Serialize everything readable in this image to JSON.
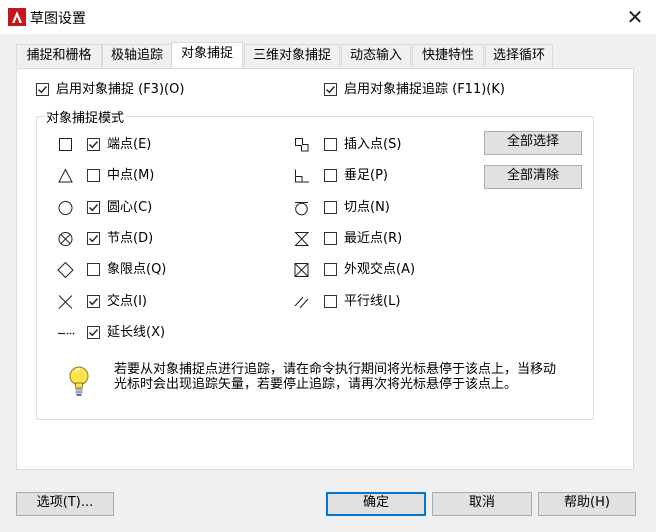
{
  "window": {
    "title": "草图设置",
    "close_icon": "close-icon",
    "app_icon": "autocad-icon"
  },
  "tabs": [
    {
      "label": "捕捉和栅格"
    },
    {
      "label": "极轴追踪"
    },
    {
      "label": "对象捕捉",
      "active": true
    },
    {
      "label": "三维对象捕捉"
    },
    {
      "label": "动态输入"
    },
    {
      "label": "快捷特性"
    },
    {
      "label": "选择循环"
    }
  ],
  "top_options": {
    "enable_snap": {
      "label": "启用对象捕捉 (F3)(O)",
      "checked": true
    },
    "enable_tracking": {
      "label": "启用对象捕捉追踪 (F11)(K)",
      "checked": true
    }
  },
  "group": {
    "title": "对象捕捉模式"
  },
  "snap_modes_left": [
    {
      "label": "端点(E)",
      "checked": true,
      "icon": "endpoint-marker-icon"
    },
    {
      "label": "中点(M)",
      "checked": false,
      "icon": "midpoint-marker-icon"
    },
    {
      "label": "圆心(C)",
      "checked": true,
      "icon": "center-marker-icon"
    },
    {
      "label": "节点(D)",
      "checked": true,
      "icon": "node-marker-icon"
    },
    {
      "label": "象限点(Q)",
      "checked": false,
      "icon": "quadrant-marker-icon"
    },
    {
      "label": "交点(I)",
      "checked": true,
      "icon": "intersection-marker-icon"
    },
    {
      "label": "延长线(X)",
      "checked": true,
      "icon": "extension-marker-icon"
    }
  ],
  "snap_modes_right": [
    {
      "label": "插入点(S)",
      "checked": false,
      "icon": "insertion-marker-icon"
    },
    {
      "label": "垂足(P)",
      "checked": false,
      "icon": "perpendicular-marker-icon"
    },
    {
      "label": "切点(N)",
      "checked": false,
      "icon": "tangent-marker-icon"
    },
    {
      "label": "最近点(R)",
      "checked": false,
      "icon": "nearest-marker-icon"
    },
    {
      "label": "外观交点(A)",
      "checked": false,
      "icon": "apparent-intersection-marker-icon"
    },
    {
      "label": "平行线(L)",
      "checked": false,
      "icon": "parallel-marker-icon"
    }
  ],
  "buttons": {
    "select_all": "全部选择",
    "clear_all": "全部清除",
    "options": "选项(T)...",
    "ok": "确定",
    "cancel": "取消",
    "help": "帮助(H)"
  },
  "hint": {
    "icon": "lightbulb-icon",
    "text": "若要从对象捕捉点进行追踪，请在命令执行期间将光标悬停于该点上，当移动光标时会出现追踪矢量，若要停止追踪，请再次将光标悬停于该点上。"
  }
}
